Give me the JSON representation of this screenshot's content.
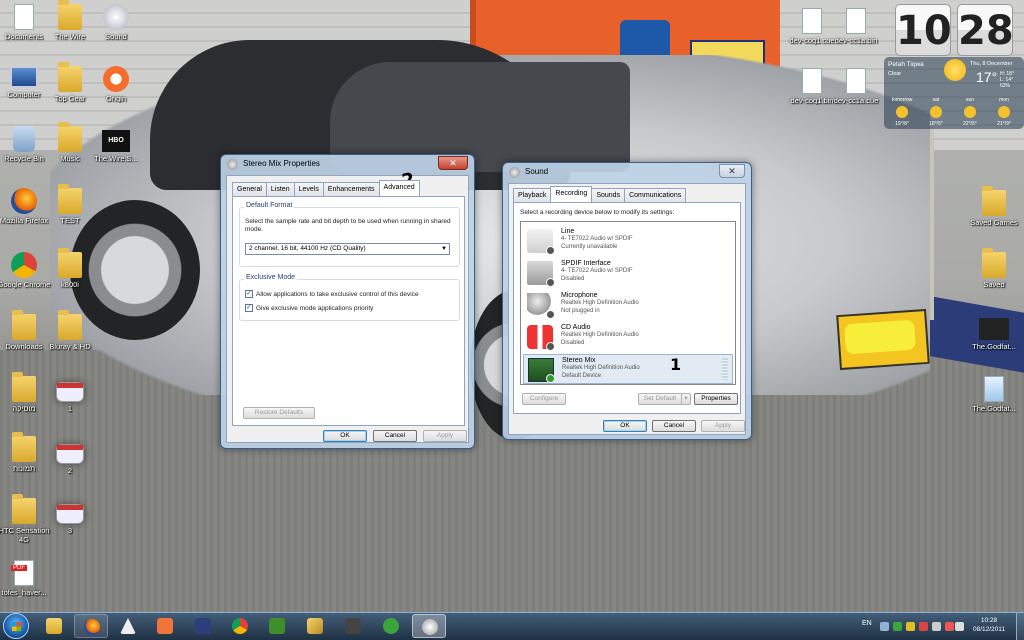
{
  "desktop": {
    "icons_left": [
      {
        "label": "Documents",
        "kind": "doc-folder"
      },
      {
        "label": "The Wire",
        "kind": "folder"
      },
      {
        "label": "Sound",
        "kind": "sound"
      },
      {
        "label": "Computer",
        "kind": "computer"
      },
      {
        "label": "Top Gear",
        "kind": "folder"
      },
      {
        "label": "Origin",
        "kind": "origin"
      },
      {
        "label": "Recycle Bin",
        "kind": "bin"
      },
      {
        "label": "Music",
        "kind": "folder"
      },
      {
        "label": "The.Wire.S...",
        "kind": "hbo"
      },
      {
        "label": "Mozilla Firefox",
        "kind": "firefox"
      },
      {
        "label": "TEST",
        "kind": "folder"
      },
      {
        "label": "Google Chrome",
        "kind": "chrome"
      },
      {
        "label": "k800i",
        "kind": "folder"
      },
      {
        "label": "Downloads",
        "kind": "folder"
      },
      {
        "label": "Bluray & HD",
        "kind": "folder"
      },
      {
        "label": "מוסיקה",
        "kind": "folder"
      },
      {
        "label": "1",
        "kind": "window-thumb"
      },
      {
        "label": "תמונות",
        "kind": "folder"
      },
      {
        "label": "2",
        "kind": "window-thumb"
      },
      {
        "label": "HTC Sensation 4G",
        "kind": "folder"
      },
      {
        "label": "3",
        "kind": "window-thumb"
      },
      {
        "label": "tofes_haver...",
        "kind": "pdf"
      }
    ],
    "icons_right": [
      {
        "label": "dev-cog1.cue",
        "kind": "doc"
      },
      {
        "label": "dev-cc1a.bin",
        "kind": "doc"
      },
      {
        "label": "dev-cog1.bin",
        "kind": "doc"
      },
      {
        "label": "dev-cc1a.cue",
        "kind": "doc"
      },
      {
        "label": "Saved Games",
        "kind": "folder"
      },
      {
        "label": "Saved",
        "kind": "folder"
      },
      {
        "label": "The.Godfat...",
        "kind": "dark"
      },
      {
        "label": "The.Godfat...",
        "kind": "video"
      }
    ]
  },
  "gadgets": {
    "clock": {
      "hour": "10",
      "minute": "28"
    },
    "weather": {
      "city": "Petah Tiqwa",
      "condition": "Clear",
      "date": "Thu, 8 December",
      "temp": "17°",
      "high": "H: 18°",
      "low": "L: 14°",
      "humidity": "63%",
      "forecast": [
        {
          "day": "tomorrow",
          "temps": "19°/8°"
        },
        {
          "day": "sat",
          "temps": "18°/5°"
        },
        {
          "day": "sun",
          "temps": "22°/5°"
        },
        {
          "day": "mon",
          "temps": "21°/9°"
        }
      ]
    }
  },
  "stereo_mix_window": {
    "title": "Stereo Mix Properties",
    "tabs": [
      "General",
      "Listen",
      "Levels",
      "Enhancements",
      "Advanced"
    ],
    "active_tab": "Advanced",
    "default_format": {
      "group_label": "Default Format",
      "description": "Select the sample rate and bit depth to be used when running in shared mode.",
      "selected": "2 channel, 16 bit, 44100 Hz (CD Quality)"
    },
    "exclusive_mode": {
      "group_label": "Exclusive Mode",
      "option1": "Allow applications to take exclusive control of this device",
      "option1_checked": true,
      "option2": "Give exclusive mode applications priority",
      "option2_checked": true
    },
    "restore_label": "Restore Defaults",
    "ok_label": "OK",
    "cancel_label": "Cancel",
    "apply_label": "Apply",
    "annotation": "2"
  },
  "sound_window": {
    "title": "Sound",
    "tabs": [
      "Playback",
      "Recording",
      "Sounds",
      "Communications"
    ],
    "active_tab": "Recording",
    "instruction": "Select a recording device below to modify its settings:",
    "devices": [
      {
        "name": "Line",
        "driver": "4- TE7022 Audio w/ SPDIF",
        "status": "Currently unavailable",
        "icon": "line-jack-icon",
        "selected": false
      },
      {
        "name": "SPDIF Interface",
        "driver": "4- TE7022 Audio w/ SPDIF",
        "status": "Disabled",
        "icon": "spdif-icon",
        "selected": false
      },
      {
        "name": "Microphone",
        "driver": "Realtek High Definition Audio",
        "status": "Not plugged in",
        "icon": "microphone-icon",
        "selected": false
      },
      {
        "name": "CD Audio",
        "driver": "Realtek High Definition Audio",
        "status": "Disabled",
        "icon": "cd-audio-icon",
        "selected": false
      },
      {
        "name": "Stereo Mix",
        "driver": "Realtek High Definition Audio",
        "status": "Default Device",
        "icon": "sound-card-icon",
        "selected": true
      }
    ],
    "configure_label": "Configure",
    "set_default_label": "Set Default",
    "properties_label": "Properties",
    "ok_label": "OK",
    "cancel_label": "Cancel",
    "apply_label": "Apply",
    "annotation": "1"
  },
  "taskbar": {
    "language": "EN",
    "time": "10:28",
    "date": "08/12/2011",
    "items": [
      "explorer",
      "firefox",
      "media-player",
      "mail",
      "media-classic",
      "chrome",
      "app-green",
      "pencil-app",
      "speaker-app",
      "utorrent",
      "sound-control"
    ]
  }
}
